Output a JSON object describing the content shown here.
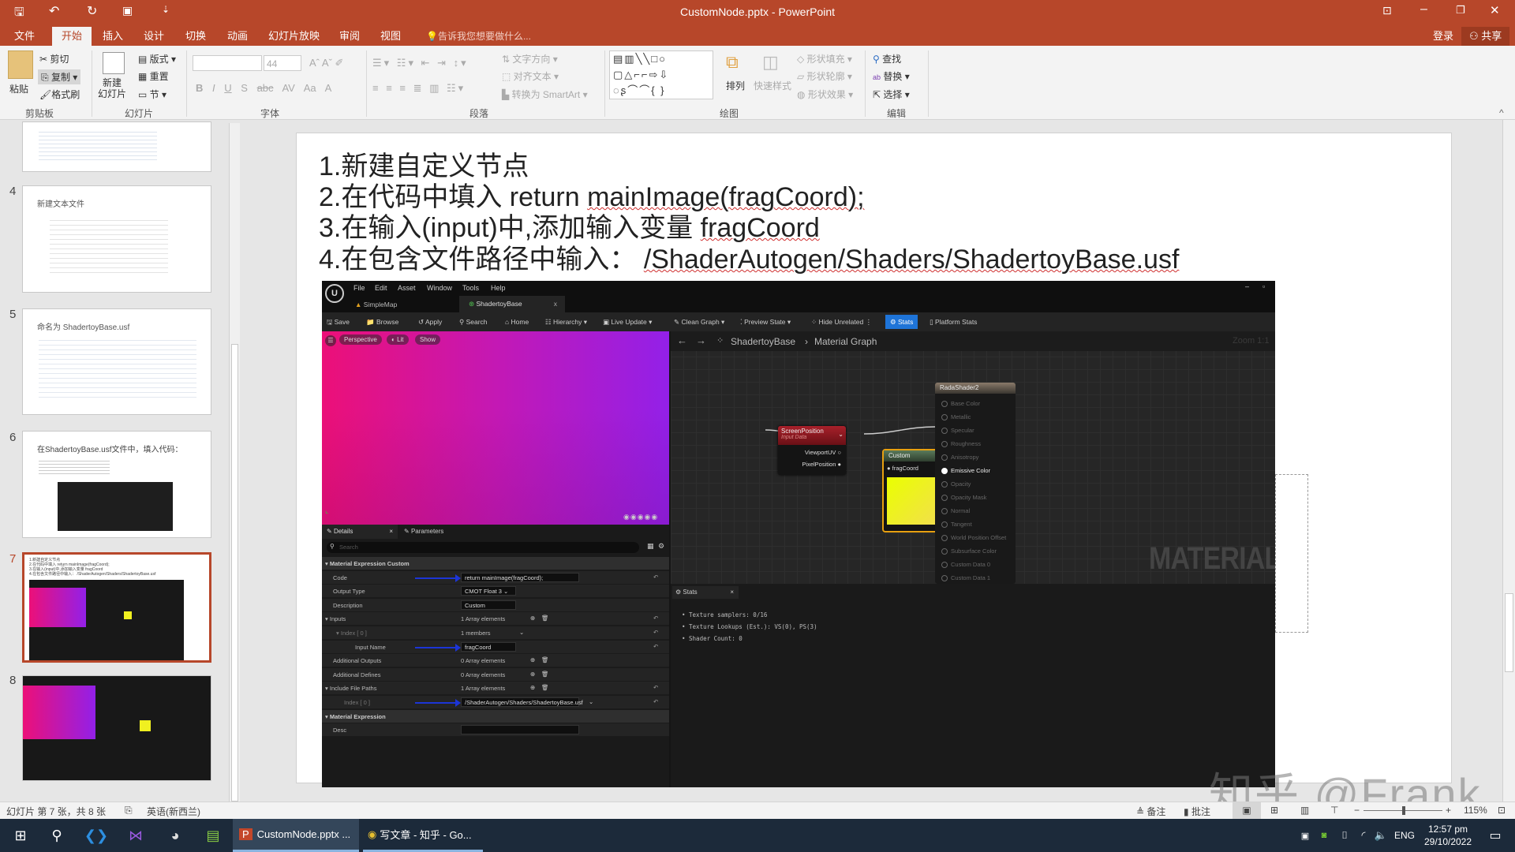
{
  "window": {
    "title": "CustomNode.pptx - PowerPoint",
    "controls": [
      "ribbon-display",
      "minimize",
      "restore",
      "close"
    ]
  },
  "ribbon_tabs": [
    "文件",
    "开始",
    "插入",
    "设计",
    "切换",
    "动画",
    "幻灯片放映",
    "审阅",
    "视图"
  ],
  "tell_me": "告诉我您想要做什么...",
  "account": {
    "signin": "登录",
    "share": "共享"
  },
  "ribbon": {
    "clipboard": {
      "paste": "粘贴",
      "cut": "剪切",
      "copy": "复制",
      "format_painter": "格式刷",
      "label": "剪贴板"
    },
    "slides": {
      "new_slide": "新建\n幻灯片",
      "layout": "版式",
      "reset": "重置",
      "section": "节",
      "label": "幻灯片"
    },
    "font": {
      "font_name": "",
      "font_size": "44",
      "label": "字体",
      "bold": "B",
      "italic": "I",
      "underline": "U",
      "shadow": "S",
      "strike": "abc",
      "spacing": "AV",
      "case": "Aa",
      "color": "A"
    },
    "paragraph": {
      "text_direction": "文字方向",
      "align_text": "对齐文本",
      "smartart": "转换为 SmartArt",
      "label": "段落"
    },
    "drawing": {
      "arrange": "排列",
      "quick_styles": "快速样式",
      "shape_fill": "形状填充",
      "shape_outline": "形状轮廓",
      "shape_effects": "形状效果",
      "label": "绘图"
    },
    "editing": {
      "find": "查找",
      "replace": "替换",
      "select": "选择",
      "label": "编辑"
    }
  },
  "thumbnails": [
    {
      "num": "",
      "title": ""
    },
    {
      "num": "4",
      "title": "新建文本文件"
    },
    {
      "num": "5",
      "title": "命名为 ShadertoyBase.usf"
    },
    {
      "num": "6",
      "title": "在ShadertoyBase.usf文件中，填入代码："
    },
    {
      "num": "7",
      "title": "1.新建自定义节点\n2.在代码中填入 return mainImage(fragCoord);\n3.在输入(input)中,添加输入变量 fragCoord\n4.在包含文件路径中输入： /ShaderAutogen/Shaders/ShadertoyBase.usf",
      "selected": true
    },
    {
      "num": "8",
      "title": ""
    }
  ],
  "slide": {
    "lines": [
      {
        "pre": "1.新建自定义节点",
        "code": ""
      },
      {
        "pre": "2.在代码中填入 return ",
        "code": "mainImage(fragCoord);"
      },
      {
        "pre": "3.在输入(input)中,添加输入变量 ",
        "code": "fragCoord"
      },
      {
        "pre": "4.在包含文件路径中输入：  ",
        "code": "/ShaderAutogen/Shaders/ShadertoyBase.usf"
      }
    ]
  },
  "ue": {
    "menu": [
      "File",
      "Edit",
      "Asset",
      "Window",
      "Tools",
      "Help"
    ],
    "tabs": [
      {
        "label": "SimpleMap"
      },
      {
        "label": "ShadertoyBase",
        "close": "x"
      }
    ],
    "toolbar": [
      "Save",
      "Browse",
      "Apply",
      "Search",
      "Home",
      "Hierarchy",
      "Live Update",
      "Clean Graph",
      "Preview State",
      "Hide Unrelated",
      "Stats",
      "Platform Stats"
    ],
    "viewport_buttons": [
      "Perspective",
      "Lit",
      "Show"
    ],
    "graph": {
      "breadcrumb_root": "ShadertoyBase",
      "breadcrumb_leaf": "Material Graph",
      "zoom": "Zoom 1:1",
      "watermark": "MATERIAL",
      "screen_position": {
        "title": "ScreenPosition",
        "subtitle": "Input Data",
        "outputs": [
          "ViewportUV",
          "PixelPosition"
        ]
      },
      "custom": {
        "title": "Custom",
        "input": "fragCoord",
        "preview_color": "#f0f020"
      },
      "material": {
        "title": "RadaShader2",
        "pins": [
          "Base Color",
          "Metallic",
          "Specular",
          "Roughness",
          "Anisotropy",
          "Emissive Color",
          "Opacity",
          "Opacity Mask",
          "Normal",
          "Tangent",
          "World Position Offset",
          "Subsurface Color",
          "Custom Data 0",
          "Custom Data 1"
        ],
        "active_pin": "Emissive Color"
      }
    },
    "details": {
      "tabs": [
        "Details",
        "Parameters"
      ],
      "search_placeholder": "Search",
      "rows": [
        {
          "name": "Material Expression Custom",
          "type": "category"
        },
        {
          "name": "Code",
          "value": "return mainImage(fragCoord);",
          "type": "box",
          "arrow": true,
          "reset": true
        },
        {
          "name": "Output Type",
          "value": "CMOT Float 3",
          "type": "dropdown"
        },
        {
          "name": "Description",
          "value": "Custom",
          "type": "box"
        },
        {
          "name": "Inputs",
          "value": "1 Array elements",
          "type": "array",
          "expand": true,
          "reset": true
        },
        {
          "name": "Index [ 0 ]",
          "value": "1 members",
          "type": "members",
          "indent": 1,
          "expand": true,
          "reset": true
        },
        {
          "name": "Input Name",
          "value": "fragCoord",
          "type": "box",
          "indent": 2,
          "arrow": true,
          "reset": true
        },
        {
          "name": "Additional Outputs",
          "value": "0 Array elements",
          "type": "array"
        },
        {
          "name": "Additional Defines",
          "value": "0 Array elements",
          "type": "array"
        },
        {
          "name": "Include File Paths",
          "value": "1 Array elements",
          "type": "array",
          "expand": true,
          "reset": true
        },
        {
          "name": "Index [ 0 ]",
          "value": "/ShaderAutogen/Shaders/ShadertoyBase.usf",
          "type": "dropdownbox",
          "indent": 1,
          "arrow": true,
          "reset": true
        },
        {
          "name": "Material Expression",
          "type": "category"
        },
        {
          "name": "Desc",
          "value": "",
          "type": "box"
        }
      ]
    },
    "stats": {
      "tab": "Stats",
      "lines": [
        "Texture samplers: 0/16",
        "Texture Lookups (Est.): VS(0), PS(3)",
        "Shader Count: 0"
      ]
    }
  },
  "watermark": "知乎 @Frank",
  "statusbar": {
    "slide_info": "幻灯片 第 7 张，共 8 张",
    "language": "英语(新西兰)",
    "notes": "备注",
    "comments": "批注",
    "zoom": "115%",
    "zoom_percent": 115
  },
  "taskbar": {
    "apps": [
      {
        "label": "CustomNode.pptx ...",
        "active": true
      },
      {
        "label": "写文章 - 知乎 - Go..."
      }
    ],
    "lang": "ENG",
    "time": "12:57 pm",
    "date": "29/10/2022"
  },
  "colors": {
    "accent": "#b7472a",
    "ue_stats_blue": "#1e74d8",
    "arrow_blue": "#1c35d6"
  }
}
